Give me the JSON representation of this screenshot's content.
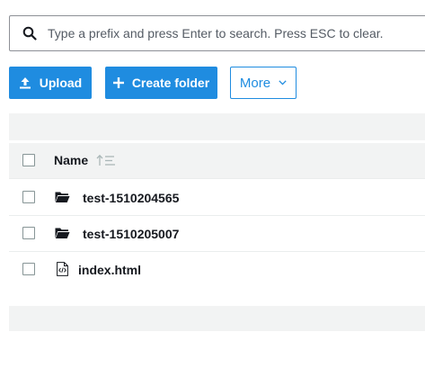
{
  "search": {
    "placeholder": "Type a prefix and press Enter to search. Press ESC to clear."
  },
  "toolbar": {
    "upload_label": "Upload",
    "create_folder_label": "Create folder",
    "more_label": "More"
  },
  "table": {
    "columns": [
      "Name"
    ],
    "rows": [
      {
        "name": "test-1510204565",
        "type": "folder",
        "icon": "folder-icon"
      },
      {
        "name": "test-1510205007",
        "type": "folder",
        "icon": "folder-icon"
      },
      {
        "name": "index.html",
        "type": "file",
        "icon": "html-file-icon"
      }
    ]
  },
  "colors": {
    "accent": "#1f8ce0",
    "band": "#f2f3f3",
    "text": "#16191f"
  }
}
